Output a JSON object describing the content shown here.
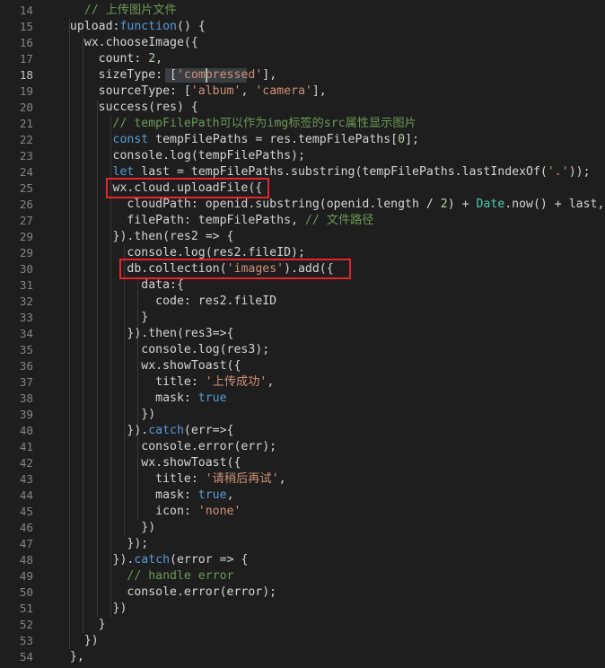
{
  "editor": {
    "active_line": 18,
    "lines": [
      {
        "num": 14,
        "tokens": [
          {
            "t": "    "
          },
          {
            "t": "// 上传图片文件",
            "c": "comment"
          }
        ]
      },
      {
        "num": 15,
        "tokens": [
          {
            "t": "  upload:"
          },
          {
            "t": "function",
            "c": "keyword"
          },
          {
            "t": "() {"
          }
        ]
      },
      {
        "num": 16,
        "tokens": [
          {
            "t": "    wx.chooseImage({"
          }
        ]
      },
      {
        "num": 17,
        "tokens": [
          {
            "t": "      count: "
          },
          {
            "t": "2",
            "c": "number"
          },
          {
            "t": ","
          }
        ]
      },
      {
        "num": 18,
        "tokens": [
          {
            "t": "      sizeType: ["
          },
          {
            "t": "'compressed'",
            "c": "string"
          },
          {
            "t": "],"
          }
        ]
      },
      {
        "num": 19,
        "tokens": [
          {
            "t": "      sourceType: ["
          },
          {
            "t": "'album'",
            "c": "string"
          },
          {
            "t": ", "
          },
          {
            "t": "'camera'",
            "c": "string"
          },
          {
            "t": "],"
          }
        ]
      },
      {
        "num": 20,
        "tokens": [
          {
            "t": "      success(res) {"
          }
        ]
      },
      {
        "num": 21,
        "tokens": [
          {
            "t": "        "
          },
          {
            "t": "// tempFilePath可以作为img标签的src属性显示图片",
            "c": "comment"
          }
        ]
      },
      {
        "num": 22,
        "tokens": [
          {
            "t": "        "
          },
          {
            "t": "const",
            "c": "keyword"
          },
          {
            "t": " tempFilePaths = res.tempFilePaths["
          },
          {
            "t": "0",
            "c": "number"
          },
          {
            "t": "];"
          }
        ]
      },
      {
        "num": 23,
        "tokens": [
          {
            "t": "        console.log(tempFilePaths);"
          }
        ]
      },
      {
        "num": 24,
        "tokens": [
          {
            "t": "        "
          },
          {
            "t": "let",
            "c": "keyword"
          },
          {
            "t": " last = tempFilePaths.substring(tempFilePaths.lastIndexOf("
          },
          {
            "t": "'.'",
            "c": "string"
          },
          {
            "t": "));"
          }
        ]
      },
      {
        "num": 25,
        "tokens": [
          {
            "t": "        wx.cloud.uploadFile({"
          }
        ]
      },
      {
        "num": 26,
        "tokens": [
          {
            "t": "          cloudPath: openid.substring(openid.length / "
          },
          {
            "t": "2",
            "c": "number"
          },
          {
            "t": ") + "
          },
          {
            "t": "Date",
            "c": "type"
          },
          {
            "t": ".now() + last,"
          }
        ]
      },
      {
        "num": 27,
        "tokens": [
          {
            "t": "          filePath: tempFilePaths, "
          },
          {
            "t": "// 文件路径",
            "c": "comment"
          }
        ]
      },
      {
        "num": 29,
        "tokens": [
          {
            "t": "        }).then(res2 => {"
          }
        ]
      },
      {
        "num": 29,
        "tokens": [
          {
            "t": "          console.log(res2.fileID);"
          }
        ]
      },
      {
        "num": 30,
        "tokens": [
          {
            "t": "          db.collection("
          },
          {
            "t": "'images'",
            "c": "string"
          },
          {
            "t": ").add({"
          }
        ]
      },
      {
        "num": 31,
        "tokens": [
          {
            "t": "            data:{"
          }
        ]
      },
      {
        "num": 32,
        "tokens": [
          {
            "t": "              code: res2.fileID"
          }
        ]
      },
      {
        "num": 33,
        "tokens": [
          {
            "t": "            }"
          }
        ]
      },
      {
        "num": 34,
        "tokens": [
          {
            "t": "          }).then(res3=>{"
          }
        ]
      },
      {
        "num": 35,
        "tokens": [
          {
            "t": "            console.log(res3);"
          }
        ]
      },
      {
        "num": 36,
        "tokens": [
          {
            "t": "            wx.showToast({"
          }
        ]
      },
      {
        "num": 37,
        "tokens": [
          {
            "t": "              title: "
          },
          {
            "t": "'上传成功'",
            "c": "string"
          },
          {
            "t": ","
          }
        ]
      },
      {
        "num": 38,
        "tokens": [
          {
            "t": "              mask: "
          },
          {
            "t": "true",
            "c": "keyword"
          }
        ]
      },
      {
        "num": 39,
        "tokens": [
          {
            "t": "            })"
          }
        ]
      },
      {
        "num": 40,
        "tokens": [
          {
            "t": "          })."
          },
          {
            "t": "catch",
            "c": "keyword"
          },
          {
            "t": "(err=>{"
          }
        ]
      },
      {
        "num": 41,
        "tokens": [
          {
            "t": "            console.error(err);"
          }
        ]
      },
      {
        "num": 42,
        "tokens": [
          {
            "t": "            wx.showToast({"
          }
        ]
      },
      {
        "num": 43,
        "tokens": [
          {
            "t": "              title: "
          },
          {
            "t": "'请稍后再试'",
            "c": "string"
          },
          {
            "t": ","
          }
        ]
      },
      {
        "num": 44,
        "tokens": [
          {
            "t": "              mask: "
          },
          {
            "t": "true",
            "c": "keyword"
          },
          {
            "t": ","
          }
        ]
      },
      {
        "num": 45,
        "tokens": [
          {
            "t": "              icon: "
          },
          {
            "t": "'none'",
            "c": "string"
          }
        ]
      },
      {
        "num": 46,
        "tokens": [
          {
            "t": "            })"
          }
        ]
      },
      {
        "num": 47,
        "tokens": [
          {
            "t": "          });"
          }
        ]
      },
      {
        "num": 48,
        "tokens": [
          {
            "t": "        })."
          },
          {
            "t": "catch",
            "c": "keyword"
          },
          {
            "t": "(error => {"
          }
        ]
      },
      {
        "num": 49,
        "tokens": [
          {
            "t": "          "
          },
          {
            "t": "// handle error",
            "c": "comment"
          }
        ]
      },
      {
        "num": 50,
        "tokens": [
          {
            "t": "          console.error(error);"
          }
        ]
      },
      {
        "num": 51,
        "tokens": [
          {
            "t": "        })"
          }
        ]
      },
      {
        "num": 52,
        "tokens": [
          {
            "t": "      }"
          }
        ]
      },
      {
        "num": 53,
        "tokens": [
          {
            "t": "    })"
          }
        ]
      },
      {
        "num": 54,
        "tokens": [
          {
            "t": "  },"
          }
        ]
      }
    ],
    "highlight_boxes": [
      {
        "label": "uploadfile-highlight",
        "line_index": 11
      },
      {
        "label": "db-collection-highlight",
        "line_index": 16
      }
    ],
    "colors": {
      "background": "#1e1e1e",
      "highlight_box": "#e4262b",
      "keyword": "#569cd6",
      "string": "#ce9178",
      "comment": "#6a9955",
      "number": "#b5cea8"
    }
  }
}
